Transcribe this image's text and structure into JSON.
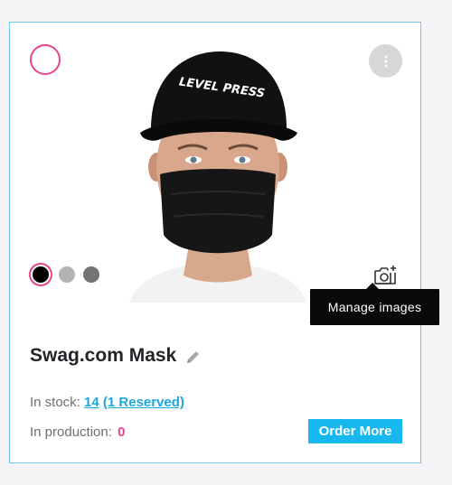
{
  "product": {
    "name": "Swag.com Mask",
    "cap_text": "LEVEL PRESS"
  },
  "swatches": [
    {
      "color": "#000000",
      "selected": true
    },
    {
      "color": "#b3b3b3",
      "selected": false
    },
    {
      "color": "#737373",
      "selected": false
    }
  ],
  "tooltip": {
    "label": "Manage images"
  },
  "inventory": {
    "in_stock_label": "In stock:",
    "in_stock_count": "14",
    "reserved_link": "(1 Reserved)",
    "in_production_label": "In production:",
    "in_production_count": "0"
  },
  "actions": {
    "order_more": "Order More"
  },
  "colors": {
    "accent_pink": "#e5458c",
    "accent_blue": "#16b8ee",
    "link_blue": "#1aa8dc",
    "card_border": "#6fcde3"
  },
  "icons": [
    "selection-circle-icon",
    "more-vertical-icon",
    "add-photo-icon",
    "pencil-icon"
  ]
}
